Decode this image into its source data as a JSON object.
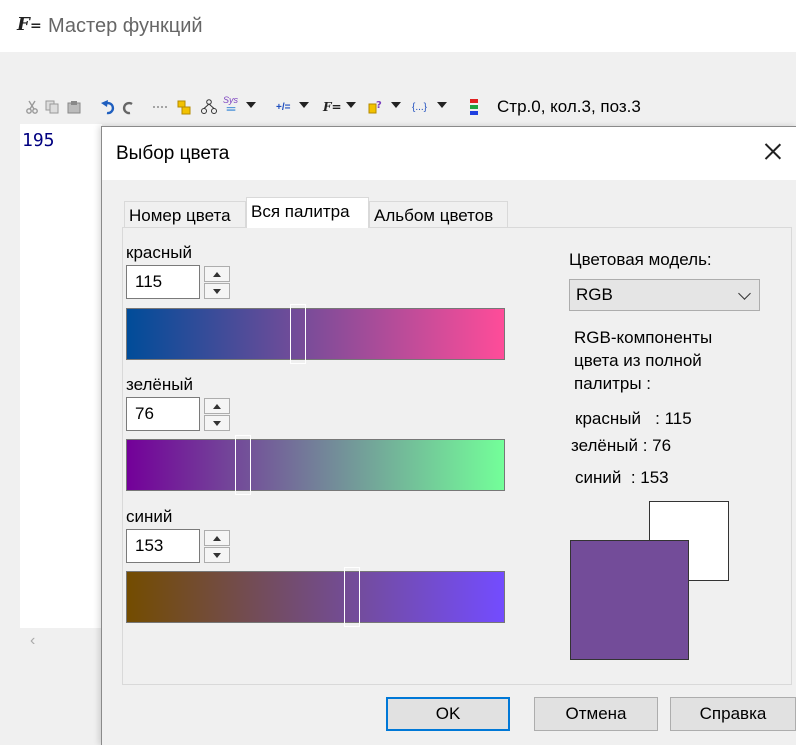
{
  "background_window": {
    "title": "Мастер функций",
    "title_icon": "F",
    "toolbar": {
      "sys_label": "Sys",
      "plusminus_label": "+/=",
      "braces_label": "{...}",
      "status": "Стр.0, кол.3, поз.3"
    },
    "editor_value": "195"
  },
  "dialog": {
    "title": "Выбор цвета",
    "tabs": [
      {
        "label": "Номер цвета",
        "active": false
      },
      {
        "label": "Вся палитра",
        "active": true
      },
      {
        "label": "Альбом цветов",
        "active": false
      }
    ],
    "channels": {
      "red": {
        "label": "красный",
        "value": "115"
      },
      "green": {
        "label": "зелёный",
        "value": "76"
      },
      "blue": {
        "label": "синий",
        "value": "153"
      }
    },
    "color_model_label": "Цветовая модель:",
    "color_model_value": "RGB",
    "components_heading": [
      "RGB-компоненты",
      "цвета из полной",
      "палитры :"
    ],
    "components": {
      "red": "красный   : 115",
      "green": "зелёный : 76",
      "blue": "синий  : 153"
    },
    "buttons": {
      "ok": "OK",
      "cancel": "Отмена",
      "help": "Справка"
    }
  },
  "colors": {
    "selected": "#734c99",
    "previous": "#ffffff",
    "red_gradient": [
      "#004c99",
      "#ff4c99"
    ],
    "green_gradient": [
      "#730099",
      "#73ff99"
    ],
    "blue_gradient": [
      "#734c00",
      "#734cff"
    ],
    "accent": "#0078d7"
  },
  "icons": [
    "scissors-icon",
    "copy-icon",
    "paste-icon",
    "undo-icon",
    "redo-icon",
    "wrap-icon",
    "tree-icon",
    "sys-icon",
    "function-icon",
    "help-icon",
    "braces-icon",
    "color-bars-icon",
    "close-icon",
    "chevron-down-icon"
  ]
}
